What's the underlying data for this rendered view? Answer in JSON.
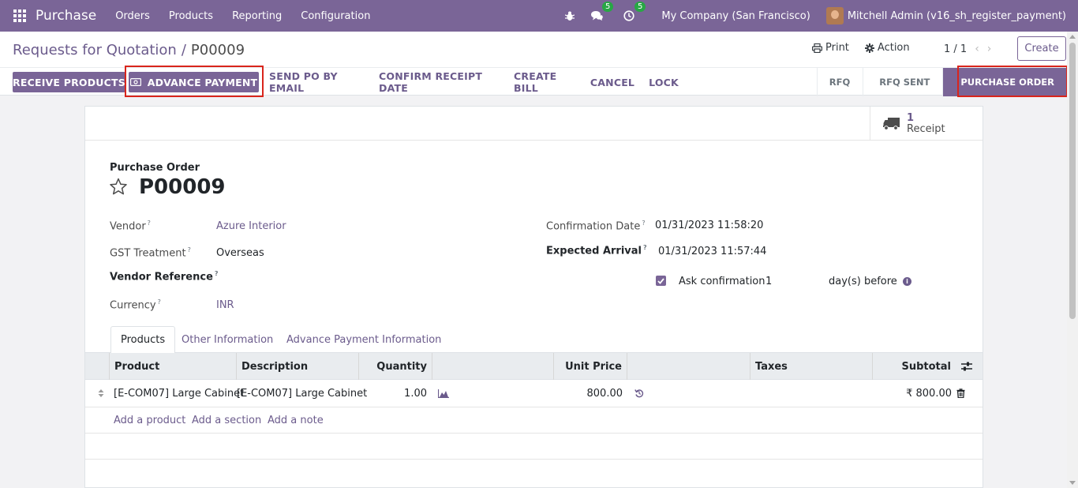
{
  "navbar": {
    "app_name": "Purchase",
    "menu": [
      "Orders",
      "Products",
      "Reporting",
      "Configuration"
    ],
    "messages_count": "5",
    "activities_count": "5",
    "company": "My Company (San Francisco)",
    "user": "Mitchell Admin (v16_sh_register_payment)"
  },
  "control_panel": {
    "breadcrumb_parent": "Requests for Quotation",
    "breadcrumb_sep": "/",
    "breadcrumb_current": "P00009",
    "print_label": "Print",
    "action_label": "Action",
    "pager": "1 / 1",
    "create_label": "Create"
  },
  "buttons": {
    "receive_products": "RECEIVE PRODUCTS",
    "advance_payment": "ADVANCE PAYMENT",
    "send_po_email": "SEND PO BY EMAIL",
    "confirm_receipt_date": "CONFIRM RECEIPT DATE",
    "create_bill": "CREATE BILL",
    "cancel": "CANCEL",
    "lock": "LOCK"
  },
  "status": {
    "stages": [
      "RFQ",
      "RFQ SENT",
      "PURCHASE ORDER"
    ],
    "active": "PURCHASE ORDER"
  },
  "smart_button": {
    "count": "1",
    "label": "Receipt"
  },
  "form": {
    "title_label": "Purchase Order",
    "name": "P00009",
    "vendor_label": "Vendor",
    "vendor": "Azure Interior",
    "gst_label": "GST Treatment",
    "gst": "Overseas",
    "vendor_ref_label": "Vendor Reference",
    "vendor_ref": "",
    "currency_label": "Currency",
    "currency": "INR",
    "confirmation_date_label": "Confirmation Date",
    "confirmation_date": "01/31/2023 11:58:20",
    "expected_arrival_label": "Expected Arrival",
    "expected_arrival": "01/31/2023 11:57:44",
    "ask_confirmation_label": "Ask confirmation",
    "ask_confirmation_days": "1",
    "days_before_label": "day(s) before",
    "help_mark": "?"
  },
  "tabs": [
    "Products",
    "Other Information",
    "Advance Payment Information"
  ],
  "table": {
    "headers": {
      "product": "Product",
      "description": "Description",
      "quantity": "Quantity",
      "unit_price": "Unit Price",
      "taxes": "Taxes",
      "subtotal": "Subtotal"
    },
    "rows": [
      {
        "product": "[E-COM07] Large Cabinet",
        "description": "[E-COM07] Large Cabinet",
        "quantity": "1.00",
        "unit_price": "800.00",
        "taxes": "",
        "subtotal": "₹ 800.00"
      }
    ],
    "add_product": "Add a product",
    "add_section": "Add a section",
    "add_note": "Add a note"
  }
}
